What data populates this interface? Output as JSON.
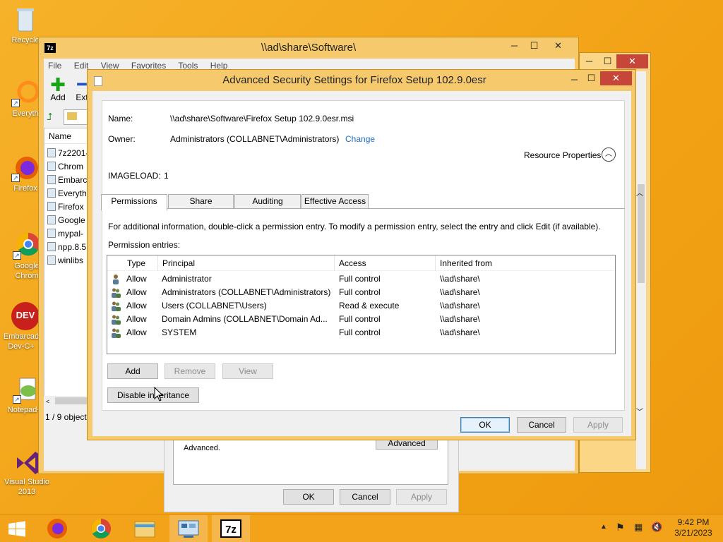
{
  "desktop": {
    "icons": [
      {
        "label": "Recycle",
        "icon": "recycle-bin-icon"
      },
      {
        "label": "Everyth",
        "icon": "everything-icon"
      },
      {
        "label": "Firefox",
        "icon": "firefox-icon"
      },
      {
        "label": "Google Chrom",
        "icon": "chrome-icon"
      },
      {
        "label": "Embarcad Dev-C+",
        "icon": "devcpp-icon"
      },
      {
        "label": "Notepad++",
        "icon": "notepadpp-icon"
      },
      {
        "label": "Visual Studio 2013",
        "icon": "visual-studio-icon"
      }
    ]
  },
  "zip_window": {
    "title": "\\\\ad\\share\\Software\\",
    "menu": [
      "File",
      "Edit",
      "View",
      "Favorites",
      "Tools",
      "Help"
    ],
    "toolbar": {
      "add": "Add",
      "extract": "Ext"
    },
    "list_header": "Name",
    "files": [
      "7z2201-",
      "Chrom",
      "Embarc",
      "Everyth",
      "Firefox",
      "Google",
      "mypal-",
      "npp.8.5",
      "winlibs"
    ],
    "status": "1 / 9 object"
  },
  "props_window": {
    "advanced_text": "Advanced.",
    "advanced_button": "Advanced",
    "ok": "OK",
    "cancel": "Cancel",
    "apply": "Apply"
  },
  "dialog": {
    "title": "Advanced Security Settings for Firefox Setup 102.9.0esr",
    "name_label": "Name:",
    "name_value": "\\\\ad\\share\\Software\\Firefox Setup 102.9.0esr.msi",
    "owner_label": "Owner:",
    "owner_value": "Administrators (COLLABNET\\Administrators)",
    "change_link": "Change",
    "resource_properties": "Resource Properties",
    "imageload_label": "IMAGELOAD:",
    "imageload_value": "1",
    "tabs": [
      "Permissions",
      "Share",
      "Auditing",
      "Effective Access"
    ],
    "info_text": "For additional information, double-click a permission entry. To modify a permission entry, select the entry and click Edit (if available).",
    "entries_label": "Permission entries:",
    "columns": [
      "Type",
      "Principal",
      "Access",
      "Inherited from"
    ],
    "entries": [
      {
        "type": "Allow",
        "principal": "Administrator",
        "access": "Full control",
        "inherited": "\\\\ad\\share\\"
      },
      {
        "type": "Allow",
        "principal": "Administrators (COLLABNET\\Administrators)",
        "access": "Full control",
        "inherited": "\\\\ad\\share\\"
      },
      {
        "type": "Allow",
        "principal": "Users (COLLABNET\\Users)",
        "access": "Read & execute",
        "inherited": "\\\\ad\\share\\"
      },
      {
        "type": "Allow",
        "principal": "Domain Admins (COLLABNET\\Domain Ad...",
        "access": "Full control",
        "inherited": "\\\\ad\\share\\"
      },
      {
        "type": "Allow",
        "principal": "SYSTEM",
        "access": "Full control",
        "inherited": "\\\\ad\\share\\"
      }
    ],
    "add": "Add",
    "remove": "Remove",
    "view": "View",
    "disable_inheritance": "Disable inheritance",
    "ok": "OK",
    "cancel": "Cancel",
    "apply": "Apply"
  },
  "taskbar": {
    "apps": [
      "firefox-icon",
      "chrome-icon",
      "file-explorer-icon",
      "control-panel-icon",
      "7zip-icon"
    ],
    "time": "9:42 PM",
    "date": "3/21/2023"
  }
}
